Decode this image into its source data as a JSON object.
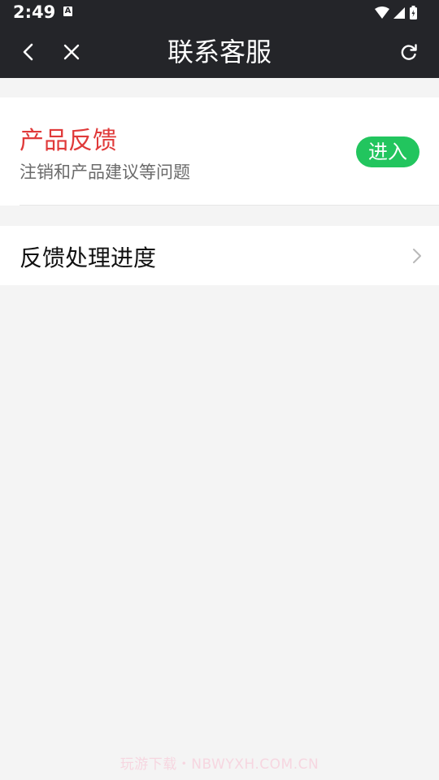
{
  "status_bar": {
    "time": "2:49",
    "notification_icon": "a-letter-icon",
    "notification_letter": "A",
    "right_icons": [
      "wifi-icon",
      "signal-icon",
      "battery-icon"
    ]
  },
  "nav": {
    "title": "联系客服",
    "back_icon": "chevron-left-icon",
    "close_icon": "close-icon",
    "refresh_icon": "refresh-icon"
  },
  "feedback_card": {
    "title": "产品反馈",
    "subtitle": "注销和产品建议等问题",
    "enter_label": "进入",
    "title_color": "#e03a3a",
    "enter_color": "#22c55e"
  },
  "progress_item": {
    "label": "反馈处理进度",
    "chevron_icon": "chevron-right-icon"
  },
  "watermark": {
    "text": "玩游下载・NBWYXH.COM.CN"
  },
  "colors": {
    "nav_bg": "#242529",
    "page_bg": "#f4f4f4",
    "card_bg": "#ffffff"
  }
}
